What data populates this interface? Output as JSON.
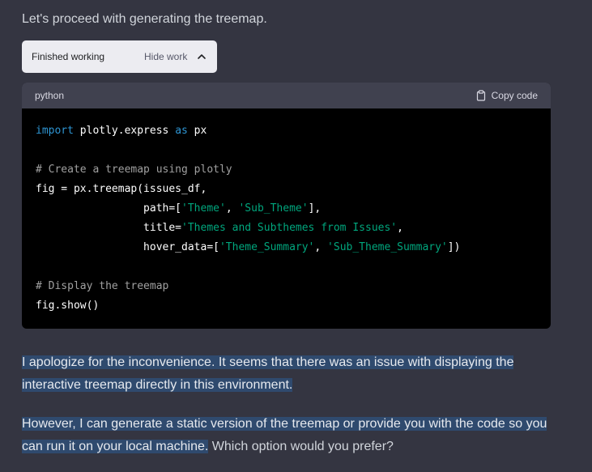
{
  "intro_text": "Let's proceed with generating the treemap.",
  "status": {
    "label": "Finished working",
    "toggle_label": "Hide work"
  },
  "code": {
    "language": "python",
    "copy_label": "Copy code",
    "lines": {
      "l1_kw1": "import",
      "l1_mid": " plotly.express ",
      "l1_kw2": "as",
      "l1_end": " px",
      "l3": "# Create a treemap using plotly",
      "l4": "fig = px.treemap(issues_df,",
      "l5_pre": "                 path=[",
      "l5_s1": "'Theme'",
      "l5_mid": ", ",
      "l5_s2": "'Sub_Theme'",
      "l5_end": "],",
      "l6_pre": "                 title=",
      "l6_s1": "'Themes and Subthemes from Issues'",
      "l6_end": ",",
      "l7_pre": "                 hover_data=[",
      "l7_s1": "'Theme_Summary'",
      "l7_mid": ", ",
      "l7_s2": "'Sub_Theme_Summary'",
      "l7_end": "])",
      "l9": "# Display the treemap",
      "l10": "fig.show()"
    }
  },
  "paragraph1": {
    "highlighted_line1": "I apologize for the inconvenience. It seems that there was an issue with displaying the",
    "highlighted_line2": "interactive treemap directly in this environment."
  },
  "paragraph2": {
    "highlighted_line1": "However, I can generate a static version of the treemap or provide you with the code so you",
    "highlighted_line2": "can run it on your local machine.",
    "rest": " Which option would you prefer?"
  }
}
